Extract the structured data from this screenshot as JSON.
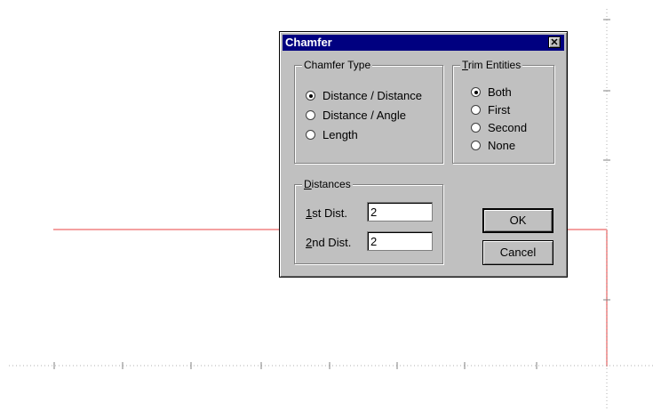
{
  "colors": {
    "entity_line": "#f4a0a0",
    "dialog_face": "#c0c0c0",
    "title_bar": "#000080"
  },
  "dialog": {
    "title": "Chamfer",
    "close_icon": "close-icon"
  },
  "chamfer_type": {
    "label": "Chamfer Type",
    "options": [
      {
        "label": "Distance / Distance",
        "checked": true
      },
      {
        "label": "Distance / Angle",
        "checked": false
      },
      {
        "label": "Length",
        "checked": false
      }
    ]
  },
  "trim_entities": {
    "label_prefix": "T",
    "label_rest": "rim Entities",
    "options": [
      {
        "label": "Both",
        "checked": true
      },
      {
        "label": "First",
        "checked": false
      },
      {
        "label": "Second",
        "checked": false
      },
      {
        "label": "None",
        "checked": false
      }
    ]
  },
  "distances": {
    "label_prefix": "D",
    "label_rest": "istances",
    "first": {
      "label_prefix": "1",
      "label_rest": "st Dist.",
      "value": "2"
    },
    "second": {
      "label_prefix": "2",
      "label_rest": "nd Dist.",
      "value": "2"
    }
  },
  "buttons": {
    "ok": "OK",
    "cancel": "Cancel"
  }
}
